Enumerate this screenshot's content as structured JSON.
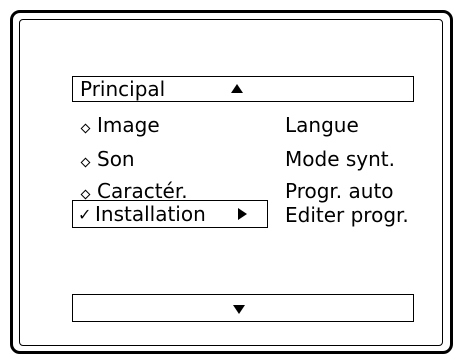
{
  "menu": {
    "title": "Principal",
    "items": [
      {
        "label": "Image",
        "marker": "diamond-icon"
      },
      {
        "label": "Son",
        "marker": "diamond-icon"
      },
      {
        "label": "Caractér.",
        "marker": "diamond-icon"
      },
      {
        "label": "Installation",
        "marker": "checkmark-icon",
        "selected": true
      }
    ],
    "submenu": [
      "Langue",
      "Mode synt.",
      "Progr. auto",
      "Editer progr."
    ],
    "check_glyph": "✓"
  }
}
